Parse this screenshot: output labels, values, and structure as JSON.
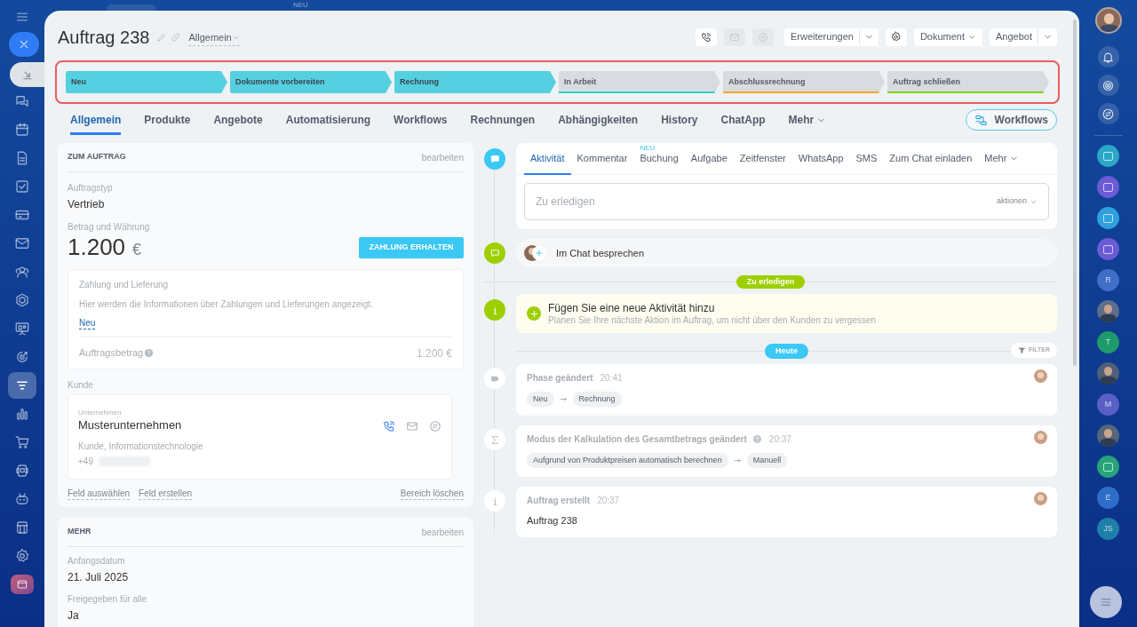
{
  "top_badge": "NEU",
  "left_nav": [
    {
      "selected": false
    },
    {
      "selected": false
    },
    {
      "selected": false
    },
    {
      "selected": false
    },
    {
      "selected": false
    },
    {
      "selected": false
    },
    {
      "selected": false
    },
    {
      "selected": false
    },
    {
      "selected": false
    },
    {
      "selected": false
    },
    {
      "selected": true
    },
    {
      "selected": false
    },
    {
      "selected": false
    },
    {
      "selected": false
    },
    {
      "selected": false
    },
    {
      "selected": false
    },
    {
      "selected": false
    },
    {
      "selected": false
    }
  ],
  "title": "Auftrag 238",
  "category": "Allgemein",
  "header_actions": [
    {
      "kind": "phone",
      "disabled": false
    },
    {
      "kind": "mail",
      "disabled": true
    },
    {
      "kind": "chat",
      "disabled": true
    }
  ],
  "header_buttons": [
    {
      "kind": "split",
      "label": "Erweiterungen"
    },
    {
      "kind": "gear"
    },
    {
      "kind": "dropdown",
      "label": "Dokument"
    },
    {
      "kind": "split",
      "label": "Angebot"
    }
  ],
  "stages": [
    {
      "label": "Neu",
      "reached": true,
      "color": "#55d0e0"
    },
    {
      "label": "Dokumente vorbereiten",
      "reached": true,
      "color": "#55d0e0"
    },
    {
      "label": "Rechnung",
      "reached": true,
      "color": "#55d0e0"
    },
    {
      "label": "In Arbeit",
      "reached": false,
      "color": "#2fd1c0"
    },
    {
      "label": "Abschlussrechnung",
      "reached": false,
      "color": "#f5a623"
    },
    {
      "label": "Auftrag schließen",
      "reached": false,
      "color": "#7bd500"
    }
  ],
  "tabs": [
    {
      "label": "Allgemein",
      "selected": true
    },
    {
      "label": "Produkte",
      "selected": false
    },
    {
      "label": "Angebote",
      "selected": false
    },
    {
      "label": "Automatisierung",
      "selected": false
    },
    {
      "label": "Workflows",
      "selected": false
    },
    {
      "label": "Rechnungen",
      "selected": false
    },
    {
      "label": "Abhängigkeiten",
      "selected": false
    },
    {
      "label": "History",
      "selected": false
    },
    {
      "label": "ChatApp",
      "selected": false
    }
  ],
  "tabs_more": "Mehr",
  "workflows_button": "Workflows",
  "order_card": {
    "heading": "ZUM AUFTRAG",
    "edit": "bearbeiten",
    "type_label": "Auftragstyp",
    "type_value": "Vertrieb",
    "amount_label": "Betrag und Währung",
    "amount": "1.200",
    "currency": "€",
    "pay_button": "ZAHLUNG ERHALTEN",
    "payment_box": {
      "title": "Zahlung und Lieferung",
      "text": "Hier werden die Informationen über Zahlungen und Lieferungen angezeigt.",
      "link": "Neu",
      "total_label": "Auftragsbetrag",
      "total": "1.200 €"
    },
    "client_label": "Kunde",
    "client": {
      "type": "Unternehmen",
      "name": "Musterunternehmen",
      "details": "Kunde, Informationstechnologie",
      "phone": "+49"
    },
    "footer_links": [
      "Feld auswählen",
      "Feld erstellen"
    ],
    "delete_link": "Bereich löschen"
  },
  "more_card": {
    "heading": "MEHR",
    "edit": "bearbeiten",
    "fields": [
      {
        "label": "Anfangsdatum",
        "value": "21. Juli 2025"
      },
      {
        "label": "Freigegeben für alle",
        "value": "Ja"
      }
    ]
  },
  "composer_tabs": [
    {
      "label": "Aktivität",
      "selected": true
    },
    {
      "label": "Kommentar",
      "selected": false
    },
    {
      "label": "Buchung",
      "selected": false,
      "badge": "NEU"
    },
    {
      "label": "Aufgabe",
      "selected": false
    },
    {
      "label": "Zeitfenster",
      "selected": false
    },
    {
      "label": "WhatsApp",
      "selected": false
    },
    {
      "label": "SMS",
      "selected": false
    },
    {
      "label": "Zum Chat einladen",
      "selected": false
    }
  ],
  "composer_more": "Mehr",
  "composer_placeholder": "Zu erledigen",
  "composer_actions": "aktionen",
  "chat_prompt": "Im Chat besprechen",
  "todo_divider": "Zu erledigen",
  "suggestion": {
    "title": "Fügen Sie eine neue Aktivität hinzu",
    "text": "Planen Sie Ihre nächste Aktion im Auftrag, um nicht über den Kunden zu vergessen"
  },
  "today_divider": "Heute",
  "filter": "FILTER",
  "events": [
    {
      "kind": "stage",
      "title": "Phase geändert",
      "time": "20:41",
      "help": false,
      "from": "Neu",
      "to": "Rechnung"
    },
    {
      "kind": "calc",
      "title": "Modus der Kalkulation des Gesamtbetrags geändert",
      "time": "20:37",
      "help": true,
      "from": "Aufgrund von Produktpreisen automatisch berechnen",
      "to": "Manuell"
    },
    {
      "kind": "created",
      "title": "Auftrag erstellt",
      "time": "20:37",
      "help": false,
      "text": "Auftrag 238"
    }
  ],
  "right_bar": [
    {
      "kind": "icon",
      "color": "#2aa7c7"
    },
    {
      "kind": "icon",
      "color": "#6b5bd6"
    },
    {
      "kind": "icon",
      "color": "#2fa0e0"
    },
    {
      "kind": "icon",
      "color": "#6b5bd6"
    },
    {
      "kind": "letter",
      "initials": "R",
      "color": "#3f6fc8"
    },
    {
      "kind": "photo",
      "color": "#5d6f8a"
    },
    {
      "kind": "letter",
      "initials": "T",
      "color": "#1f9a6a"
    },
    {
      "kind": "photo",
      "color": "#4f6078"
    },
    {
      "kind": "letter",
      "initials": "M",
      "color": "#5a5fc8"
    },
    {
      "kind": "photo",
      "color": "#56667c"
    },
    {
      "kind": "icon",
      "color": "#27a37a"
    },
    {
      "kind": "letter",
      "initials": "E",
      "color": "#2f6ec8"
    },
    {
      "kind": "letter",
      "initials": "JS",
      "color": "#1f7fa8"
    }
  ]
}
